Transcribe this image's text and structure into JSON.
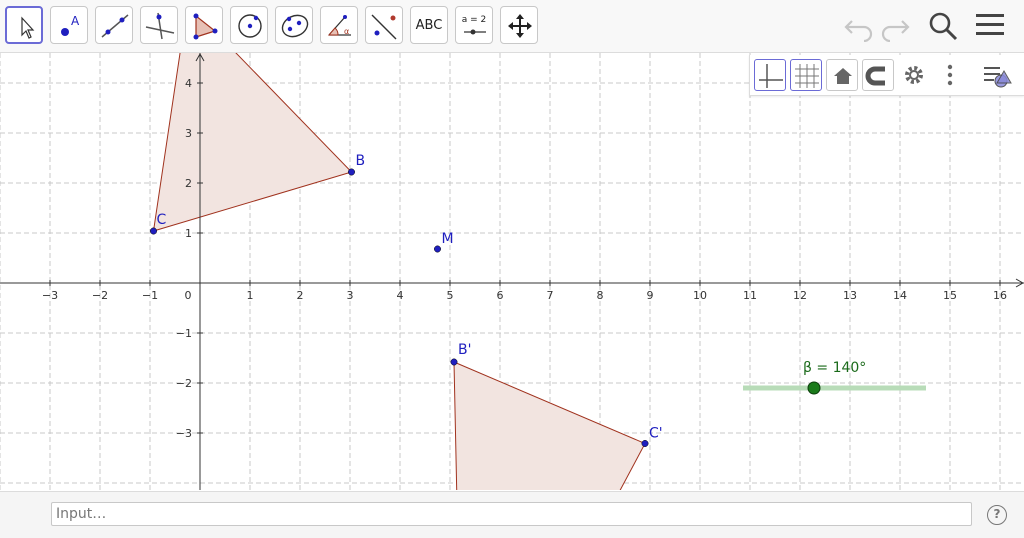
{
  "toolbar": {
    "label_abc": "ABC",
    "label_slider": "a = 2",
    "tools": [
      "move-tool",
      "point-tool",
      "line-tool",
      "perpendicular-line-tool",
      "polygon-tool",
      "circle-center-tool",
      "conic-tool",
      "angle-tool",
      "reflect-tool",
      "text-tool",
      "slider-tool",
      "move-graphics-view-tool"
    ],
    "right_icons": [
      "undo-icon",
      "redo-icon",
      "search-icon",
      "menu-icon"
    ]
  },
  "graphics": {
    "x_ticks": [
      "−3",
      "−2",
      "−1",
      "0",
      "1",
      "2",
      "3",
      "4",
      "5",
      "6",
      "7",
      "8",
      "9",
      "10",
      "11",
      "12",
      "13",
      "14",
      "15",
      "16"
    ],
    "y_ticks": [
      "4",
      "3",
      "2",
      "1",
      "−1",
      "−2",
      "−3"
    ],
    "points": {
      "B": "B",
      "C": "C",
      "M": "M",
      "B_prime": "B'",
      "C_prime": "C'"
    },
    "slider_label": "β = 140°",
    "slider_value_deg": 140
  },
  "style_bar": {
    "buttons": [
      "axes-toggle",
      "grid-toggle",
      "home-view",
      "point-capturing",
      "settings-gear",
      "more-options",
      "toggle-style-bar"
    ]
  },
  "input_bar": {
    "placeholder": "Input…",
    "help_label": "?"
  },
  "colors": {
    "point": "#1f1fbf",
    "polygon_fill": "#f2e4e0",
    "polygon_stroke": "#a0321e",
    "slider": "#1a7a1a",
    "selected_tool": "#6b6bd6"
  }
}
